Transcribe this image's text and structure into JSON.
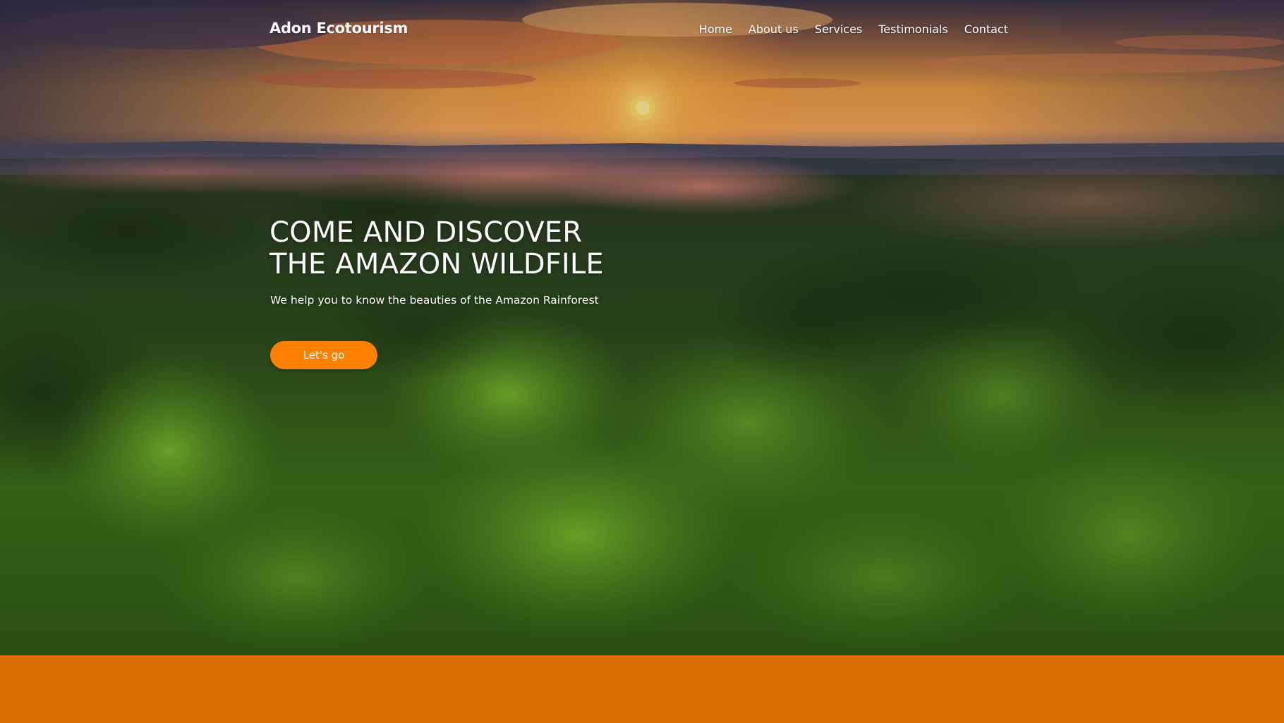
{
  "header": {
    "brand": "Adon Ecotourism",
    "nav": [
      {
        "label": "Home"
      },
      {
        "label": "About us"
      },
      {
        "label": "Services"
      },
      {
        "label": "Testimonials"
      },
      {
        "label": "Contact"
      }
    ]
  },
  "hero": {
    "title_line1": "COME AND DISCOVER",
    "title_line2": "THE AMAZON WILDFILE",
    "subtitle": "We help you to know the beauties of the Amazon Rainforest",
    "cta_label": "Let's go",
    "background_description_icon": "sunset-forest-photo"
  },
  "colors": {
    "accent_orange": "#fd7f04",
    "band_orange": "#dc6c04",
    "text": "#ffffff"
  }
}
